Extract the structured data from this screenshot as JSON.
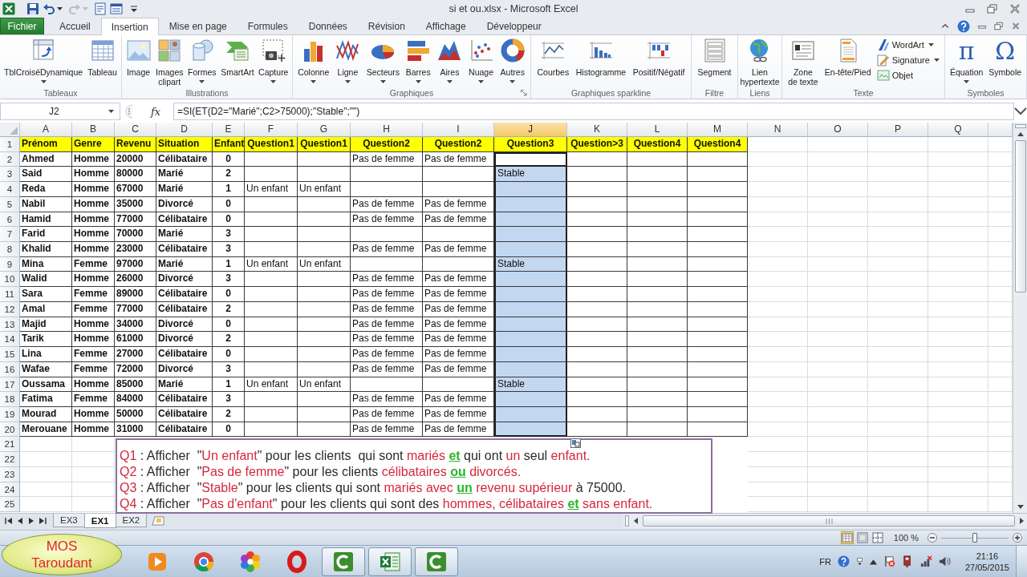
{
  "window": {
    "title": "si et ou.xlsx - Microsoft Excel"
  },
  "quick_access": [
    {
      "disabled": false
    },
    {
      "disabled": false
    },
    {
      "disabled": true
    },
    {
      "disabled": false
    },
    {
      "disabled": false
    }
  ],
  "ribbon_tabs": [
    {
      "label": "Fichier",
      "kind": "file",
      "selected": false
    },
    {
      "label": "Accueil",
      "kind": "tab",
      "selected": false
    },
    {
      "label": "Insertion",
      "kind": "tab",
      "selected": true
    },
    {
      "label": "Mise en page",
      "kind": "tab",
      "selected": false
    },
    {
      "label": "Formules",
      "kind": "tab",
      "selected": false
    },
    {
      "label": "Données",
      "kind": "tab",
      "selected": false
    },
    {
      "label": "Révision",
      "kind": "tab",
      "selected": false
    },
    {
      "label": "Affichage",
      "kind": "tab",
      "selected": false
    },
    {
      "label": "Développeur",
      "kind": "tab",
      "selected": false
    }
  ],
  "ribbon_groups": [
    {
      "label": "Tableaux",
      "launcher": false,
      "buttons": [
        {
          "label": "TblCroiséDynamique",
          "kind": "large",
          "dropdown": true
        },
        {
          "label": "Tableau",
          "kind": "large",
          "dropdown": false
        }
      ]
    },
    {
      "label": "Illustrations",
      "launcher": false,
      "buttons": [
        {
          "label": "Image",
          "kind": "large",
          "dropdown": false
        },
        {
          "label": "Images\nclipart",
          "kind": "large",
          "dropdown": false
        },
        {
          "label": "Formes",
          "kind": "large",
          "dropdown": true
        },
        {
          "label": "SmartArt",
          "kind": "large",
          "dropdown": false
        },
        {
          "label": "Capture",
          "kind": "large",
          "dropdown": true
        }
      ]
    },
    {
      "label": "Graphiques",
      "launcher": true,
      "buttons": [
        {
          "label": "Colonne",
          "kind": "large",
          "dropdown": true
        },
        {
          "label": "Ligne",
          "kind": "large",
          "dropdown": true
        },
        {
          "label": "Secteurs",
          "kind": "large",
          "dropdown": true
        },
        {
          "label": "Barres",
          "kind": "large",
          "dropdown": true
        },
        {
          "label": "Aires",
          "kind": "large",
          "dropdown": true
        },
        {
          "label": "Nuage",
          "kind": "large",
          "dropdown": true
        },
        {
          "label": "Autres",
          "kind": "large",
          "dropdown": true
        }
      ]
    },
    {
      "label": "Graphiques sparkline",
      "launcher": false,
      "buttons": [
        {
          "label": "Courbes",
          "kind": "large",
          "dropdown": false
        },
        {
          "label": "Histogramme",
          "kind": "large",
          "dropdown": false
        },
        {
          "label": "Positif/Négatif",
          "kind": "large",
          "dropdown": false
        }
      ]
    },
    {
      "label": "Filtre",
      "launcher": false,
      "buttons": [
        {
          "label": "Segment",
          "kind": "large",
          "dropdown": false
        }
      ]
    },
    {
      "label": "Liens",
      "launcher": false,
      "buttons": [
        {
          "label": "Lien\nhypertexte",
          "kind": "large",
          "dropdown": false
        }
      ]
    },
    {
      "label": "Texte",
      "launcher": false,
      "buttons": [
        {
          "label": "Zone\nde texte",
          "kind": "large",
          "dropdown": false
        },
        {
          "label": "En-tête/Pied",
          "kind": "large",
          "dropdown": false
        },
        {
          "label": "WordArt",
          "kind": "small",
          "dropdown": true
        },
        {
          "label": "Signature",
          "kind": "small",
          "dropdown": true
        },
        {
          "label": "Objet",
          "kind": "small",
          "dropdown": false
        }
      ]
    },
    {
      "label": "Symboles",
      "launcher": false,
      "buttons": [
        {
          "label": "Équation",
          "kind": "glyph",
          "glyph": "π",
          "dropdown": true
        },
        {
          "label": "Symbole",
          "kind": "glyph",
          "glyph": "Ω",
          "dropdown": false
        }
      ]
    }
  ],
  "formula_bar": {
    "name_box": "J2",
    "function_label": "fx",
    "formula": "=SI(ET(D2=\"Marié\";C2>75000);\"Stable\";\"\")"
  },
  "sheet": {
    "columns": [
      {
        "label": "A",
        "selected": false
      },
      {
        "label": "B",
        "selected": false
      },
      {
        "label": "C",
        "selected": false
      },
      {
        "label": "D",
        "selected": false
      },
      {
        "label": "E",
        "selected": false
      },
      {
        "label": "F",
        "selected": false
      },
      {
        "label": "G",
        "selected": false
      },
      {
        "label": "H",
        "selected": false
      },
      {
        "label": "I",
        "selected": false
      },
      {
        "label": "J",
        "selected": true
      },
      {
        "label": "K",
        "selected": false
      },
      {
        "label": "L",
        "selected": false
      },
      {
        "label": "M",
        "selected": false
      },
      {
        "label": "N",
        "selected": false
      },
      {
        "label": "O",
        "selected": false
      },
      {
        "label": "P",
        "selected": false
      },
      {
        "label": "Q",
        "selected": false
      }
    ],
    "rows": [
      {
        "number": "1",
        "kind": "header",
        "selected": false,
        "active": false,
        "cells": [
          "Prénom",
          "Genre",
          "Revenu",
          "Situation",
          "Enfant",
          "Question1",
          "Question1",
          "Question2",
          "Question2",
          "Question3",
          "Question>3",
          "Question4",
          "Question4"
        ]
      },
      {
        "number": "2",
        "kind": "data",
        "selected": true,
        "active": true,
        "cells": [
          "Ahmed",
          "Homme",
          "20000",
          "Célibataire",
          "0",
          null,
          null,
          "Pas de femme",
          "Pas de femme",
          null,
          null,
          null,
          null
        ]
      },
      {
        "number": "3",
        "kind": "data",
        "selected": true,
        "active": false,
        "cells": [
          "Said",
          "Homme",
          "80000",
          "Marié",
          "2",
          null,
          null,
          null,
          null,
          "Stable",
          null,
          null,
          null
        ]
      },
      {
        "number": "4",
        "kind": "data",
        "selected": true,
        "active": false,
        "cells": [
          "Reda",
          "Homme",
          "67000",
          "Marié",
          "1",
          "Un enfant",
          "Un enfant",
          null,
          null,
          null,
          null,
          null,
          null
        ]
      },
      {
        "number": "5",
        "kind": "data",
        "selected": true,
        "active": false,
        "cells": [
          "Nabil",
          "Homme",
          "35000",
          "Divorcé",
          "0",
          null,
          null,
          "Pas de femme",
          "Pas de femme",
          null,
          null,
          null,
          null
        ]
      },
      {
        "number": "6",
        "kind": "data",
        "selected": true,
        "active": false,
        "cells": [
          "Hamid",
          "Homme",
          "77000",
          "Célibataire",
          "0",
          null,
          null,
          "Pas de femme",
          "Pas de femme",
          null,
          null,
          null,
          null
        ]
      },
      {
        "number": "7",
        "kind": "data",
        "selected": true,
        "active": false,
        "cells": [
          "Farid",
          "Homme",
          "70000",
          "Marié",
          "3",
          null,
          null,
          null,
          null,
          null,
          null,
          null,
          null
        ]
      },
      {
        "number": "8",
        "kind": "data",
        "selected": true,
        "active": false,
        "cells": [
          "Khalid",
          "Homme",
          "23000",
          "Célibataire",
          "3",
          null,
          null,
          "Pas de femme",
          "Pas de femme",
          null,
          null,
          null,
          null
        ]
      },
      {
        "number": "9",
        "kind": "data",
        "selected": true,
        "active": false,
        "cells": [
          "Mina",
          "Femme",
          "97000",
          "Marié",
          "1",
          "Un enfant",
          "Un enfant",
          null,
          null,
          "Stable",
          null,
          null,
          null
        ]
      },
      {
        "number": "10",
        "kind": "data",
        "selected": true,
        "active": false,
        "cells": [
          "Walid",
          "Homme",
          "26000",
          "Divorcé",
          "3",
          null,
          null,
          "Pas de femme",
          "Pas de femme",
          null,
          null,
          null,
          null
        ]
      },
      {
        "number": "11",
        "kind": "data",
        "selected": true,
        "active": false,
        "cells": [
          "Sara",
          "Femme",
          "89000",
          "Célibataire",
          "0",
          null,
          null,
          "Pas de femme",
          "Pas de femme",
          null,
          null,
          null,
          null
        ]
      },
      {
        "number": "12",
        "kind": "data",
        "selected": true,
        "active": false,
        "cells": [
          "Amal",
          "Femme",
          "77000",
          "Célibataire",
          "2",
          null,
          null,
          "Pas de femme",
          "Pas de femme",
          null,
          null,
          null,
          null
        ]
      },
      {
        "number": "13",
        "kind": "data",
        "selected": true,
        "active": false,
        "cells": [
          "Majid",
          "Homme",
          "34000",
          "Divorcé",
          "0",
          null,
          null,
          "Pas de femme",
          "Pas de femme",
          null,
          null,
          null,
          null
        ]
      },
      {
        "number": "14",
        "kind": "data",
        "selected": true,
        "active": false,
        "cells": [
          "Tarik",
          "Homme",
          "61000",
          "Divorcé",
          "2",
          null,
          null,
          "Pas de femme",
          "Pas de femme",
          null,
          null,
          null,
          null
        ]
      },
      {
        "number": "15",
        "kind": "data",
        "selected": true,
        "active": false,
        "cells": [
          "Lina",
          "Femme",
          "27000",
          "Célibataire",
          "0",
          null,
          null,
          "Pas de femme",
          "Pas de femme",
          null,
          null,
          null,
          null
        ]
      },
      {
        "number": "16",
        "kind": "data",
        "selected": true,
        "active": false,
        "cells": [
          "Wafae",
          "Femme",
          "72000",
          "Divorcé",
          "3",
          null,
          null,
          "Pas de femme",
          "Pas de femme",
          null,
          null,
          null,
          null
        ]
      },
      {
        "number": "17",
        "kind": "data",
        "selected": true,
        "active": false,
        "cells": [
          "Oussama",
          "Homme",
          "85000",
          "Marié",
          "1",
          "Un enfant",
          "Un enfant",
          null,
          null,
          "Stable",
          null,
          null,
          null
        ]
      },
      {
        "number": "18",
        "kind": "data",
        "selected": true,
        "active": false,
        "cells": [
          "Fatima",
          "Femme",
          "84000",
          "Célibataire",
          "3",
          null,
          null,
          "Pas de femme",
          "Pas de femme",
          null,
          null,
          null,
          null
        ]
      },
      {
        "number": "19",
        "kind": "data",
        "selected": true,
        "active": false,
        "cells": [
          "Mourad",
          "Homme",
          "50000",
          "Célibataire",
          "2",
          null,
          null,
          "Pas de femme",
          "Pas de femme",
          null,
          null,
          null,
          null
        ]
      },
      {
        "number": "20",
        "kind": "data",
        "selected": true,
        "active": false,
        "cells": [
          "Merouane",
          "Homme",
          "31000",
          "Célibataire",
          "0",
          null,
          null,
          "Pas de femme",
          "Pas de femme",
          null,
          null,
          null,
          null
        ]
      },
      {
        "number": "21",
        "kind": "empty"
      },
      {
        "number": "22",
        "kind": "empty"
      },
      {
        "number": "23",
        "kind": "empty"
      },
      {
        "number": "24",
        "kind": "empty"
      },
      {
        "number": "25",
        "kind": "empty"
      }
    ]
  },
  "text_box": {
    "lines": [
      {
        "segments": [
          {
            "text": "Q1",
            "color": "#d4283c",
            "underlined": false
          },
          {
            "text": " : Afficher  \"",
            "color": "#2a2a2a",
            "underlined": false
          },
          {
            "text": "Un enfant",
            "color": "#d4283c",
            "underlined": false
          },
          {
            "text": "\" pour les clients  qui sont ",
            "color": "#2a2a2a",
            "underlined": false
          },
          {
            "text": "mariés ",
            "color": "#d4283c",
            "underlined": false
          },
          {
            "text": "et",
            "color": "#2cb52c",
            "underlined": true
          },
          {
            "text": " qui ont ",
            "color": "#2a2a2a",
            "underlined": false
          },
          {
            "text": "un",
            "color": "#d4283c",
            "underlined": false
          },
          {
            "text": " seul ",
            "color": "#2a2a2a",
            "underlined": false
          },
          {
            "text": "enfant.",
            "color": "#d4283c",
            "underlined": false
          }
        ]
      },
      {
        "segments": [
          {
            "text": "Q2",
            "color": "#d4283c",
            "underlined": false
          },
          {
            "text": " : Afficher  \"",
            "color": "#2a2a2a",
            "underlined": false
          },
          {
            "text": "Pas de femme",
            "color": "#d4283c",
            "underlined": false
          },
          {
            "text": "\" pour les clients ",
            "color": "#2a2a2a",
            "underlined": false
          },
          {
            "text": "célibataires ",
            "color": "#d4283c",
            "underlined": false
          },
          {
            "text": "ou",
            "color": "#2cb52c",
            "underlined": true
          },
          {
            "text": " divorcés.",
            "color": "#d4283c",
            "underlined": false
          }
        ]
      },
      {
        "segments": [
          {
            "text": "Q3",
            "color": "#d4283c",
            "underlined": false
          },
          {
            "text": " : Afficher  \"",
            "color": "#2a2a2a",
            "underlined": false
          },
          {
            "text": "Stable",
            "color": "#d4283c",
            "underlined": false
          },
          {
            "text": "\" pour les clients qui sont ",
            "color": "#2a2a2a",
            "underlined": false
          },
          {
            "text": "mariés avec ",
            "color": "#d4283c",
            "underlined": false
          },
          {
            "text": "un",
            "color": "#2cb52c",
            "underlined": true
          },
          {
            "text": " revenu supérieur",
            "color": "#d4283c",
            "underlined": false
          },
          {
            "text": " à 75000.",
            "color": "#2a2a2a",
            "underlined": false
          }
        ]
      },
      {
        "segments": [
          {
            "text": "Q4",
            "color": "#d4283c",
            "underlined": false
          },
          {
            "text": " : Afficher  \"",
            "color": "#2a2a2a",
            "underlined": false
          },
          {
            "text": "Pas d'enfant",
            "color": "#d4283c",
            "underlined": false
          },
          {
            "text": "\" pour les clients qui sont des ",
            "color": "#2a2a2a",
            "underlined": false
          },
          {
            "text": "hommes, célibataires ",
            "color": "#d4283c",
            "underlined": false
          },
          {
            "text": "et",
            "color": "#2cb52c",
            "underlined": true
          },
          {
            "text": " sans enfant.",
            "color": "#d4283c",
            "underlined": false
          }
        ]
      }
    ]
  },
  "sheet_tabs": [
    {
      "label": "EX3",
      "selected": false
    },
    {
      "label": "EX1",
      "selected": true
    },
    {
      "label": "EX2",
      "selected": false
    }
  ],
  "status_bar": {
    "views": [
      {
        "selected": true
      },
      {
        "selected": false
      },
      {
        "selected": false
      }
    ],
    "zoom": "100 %",
    "zoom_slider": {
      "level": 0.5
    }
  },
  "taskbar": {
    "apps": [
      {
        "open": false
      },
      {
        "open": false
      },
      {
        "open": false
      },
      {
        "open": false
      },
      {
        "open": true
      },
      {
        "open": true
      },
      {
        "open": true
      }
    ],
    "language": "FR",
    "time": "21:16",
    "date": "27/05/2015"
  },
  "channel_badge": {
    "lines": [
      "MOS",
      "Taroudant"
    ]
  }
}
